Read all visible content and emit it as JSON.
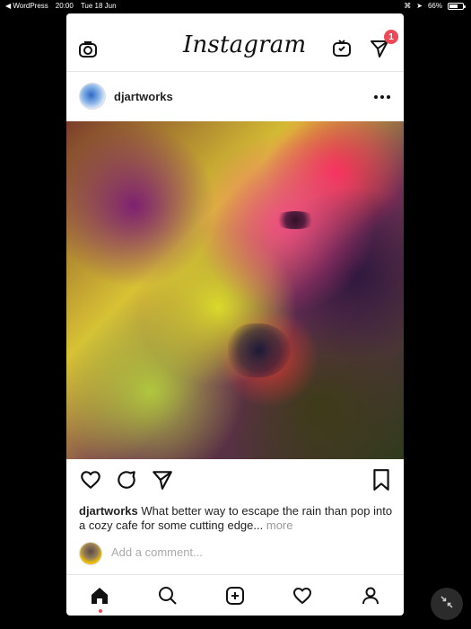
{
  "status_bar": {
    "back_app": "WordPress",
    "time": "20:00",
    "date": "Tue 18 Jun",
    "battery_percent": "66%",
    "battery_level": 0.66
  },
  "app": {
    "title": "Instagram",
    "notifications_count": "1"
  },
  "post": {
    "username": "djartworks",
    "caption_user": "djartworks",
    "caption_text": "What better way to escape the rain than pop into a cozy cafe for some cutting edge...",
    "more_label": "more"
  },
  "comment": {
    "placeholder": "Add a comment..."
  },
  "icons": {
    "camera": "camera-icon",
    "igtv": "igtv-icon",
    "direct": "direct-icon",
    "more": "more-icon",
    "like": "heart-icon",
    "comment": "comment-icon",
    "share": "share-icon",
    "save": "bookmark-icon",
    "home": "home-icon",
    "search": "search-icon",
    "add": "add-post-icon",
    "activity": "activity-heart-icon",
    "profile": "profile-icon",
    "collapse": "collapse-icon"
  },
  "colors": {
    "accent": "#ed4956",
    "text": "#222222",
    "muted": "#999999"
  }
}
